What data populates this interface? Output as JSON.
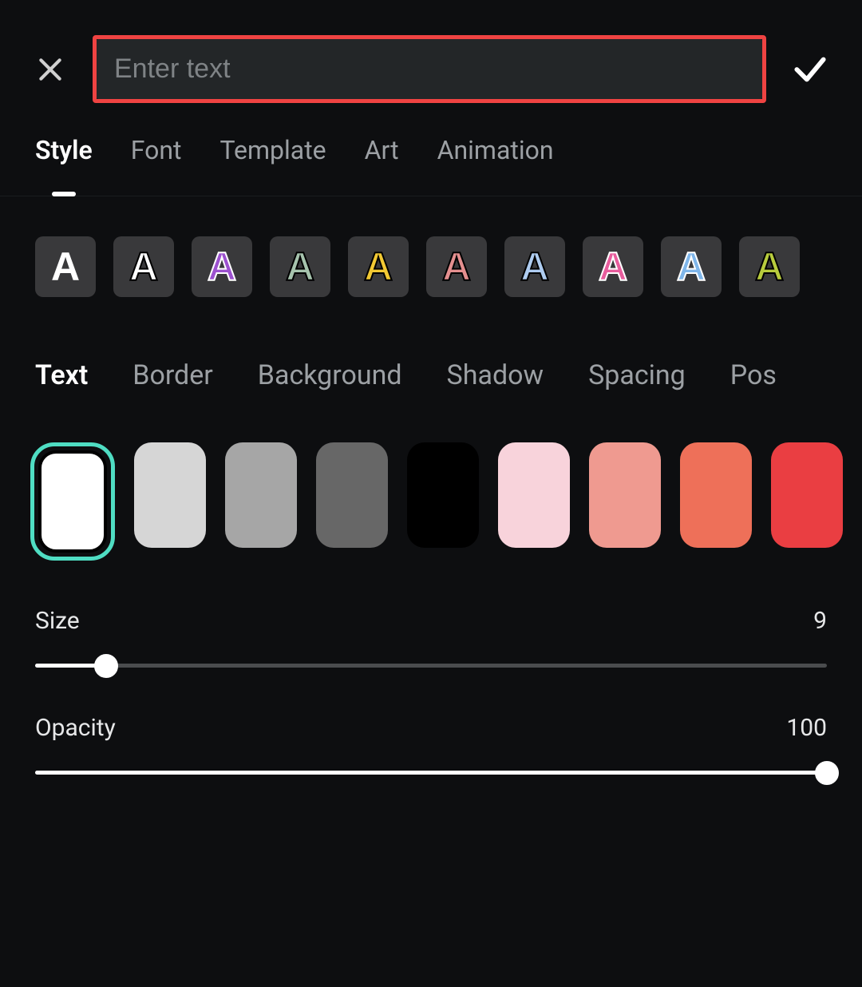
{
  "input": {
    "placeholder": "Enter text",
    "value": ""
  },
  "tabs": [
    {
      "label": "Style",
      "active": true
    },
    {
      "label": "Font",
      "active": false
    },
    {
      "label": "Template",
      "active": false
    },
    {
      "label": "Art",
      "active": false
    },
    {
      "label": "Animation",
      "active": false
    }
  ],
  "presets": [
    {
      "fill": "#ffffff",
      "stroke": "none",
      "name": "white-solid"
    },
    {
      "fill": "#ffffff",
      "stroke": "#000000",
      "name": "white-outline-black"
    },
    {
      "fill": "#9c51cf",
      "stroke": "#ffffff",
      "name": "purple-outline-white"
    },
    {
      "fill": "#a6c3ad",
      "stroke": "#000000",
      "name": "sage-outline-black"
    },
    {
      "fill": "#f2c933",
      "stroke": "#000000",
      "name": "yellow-outline-black"
    },
    {
      "fill": "#e48f8f",
      "stroke": "#000000",
      "name": "pink-outline-black"
    },
    {
      "fill": "#aeccf0",
      "stroke": "#000000",
      "name": "lightblue-outline-black"
    },
    {
      "fill": "#e85d9d",
      "stroke": "#ffffff",
      "name": "magenta-outline-white"
    },
    {
      "fill": "#7fb6ea",
      "stroke": "#ffffff",
      "name": "blue-outline-white"
    },
    {
      "fill": "#b8cc3d",
      "stroke": "#000000",
      "name": "lime-outline-black"
    }
  ],
  "subtabs": [
    {
      "label": "Text",
      "active": true
    },
    {
      "label": "Border",
      "active": false
    },
    {
      "label": "Background",
      "active": false
    },
    {
      "label": "Shadow",
      "active": false
    },
    {
      "label": "Spacing",
      "active": false
    },
    {
      "label": "Pos",
      "active": false
    }
  ],
  "colors": [
    {
      "hex": "#ffffff",
      "selected": true
    },
    {
      "hex": "#d6d6d6",
      "selected": false
    },
    {
      "hex": "#a6a6a6",
      "selected": false
    },
    {
      "hex": "#676767",
      "selected": false
    },
    {
      "hex": "#000000",
      "selected": false
    },
    {
      "hex": "#f8d3db",
      "selected": false
    },
    {
      "hex": "#ef9a90",
      "selected": false
    },
    {
      "hex": "#ee7059",
      "selected": false
    },
    {
      "hex": "#ea3e42",
      "selected": false
    }
  ],
  "sliders": {
    "size": {
      "label": "Size",
      "value": 9,
      "max": 100
    },
    "opacity": {
      "label": "Opacity",
      "value": 100,
      "max": 100
    }
  }
}
